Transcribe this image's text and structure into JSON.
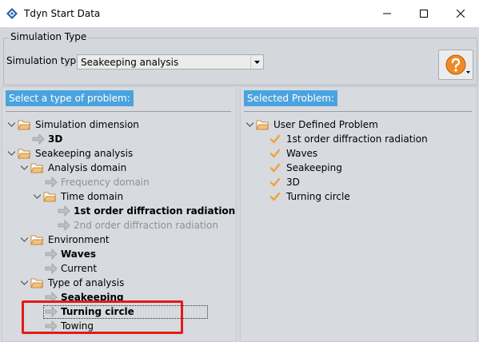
{
  "window": {
    "title": "Tdyn Start Data",
    "minimize_icon": "minimize-icon",
    "maximize_icon": "maximize-icon",
    "close_icon": "close-icon"
  },
  "simulation": {
    "group_title": "Simulation Type",
    "type_label": "Simulation type:",
    "type_value": "Seakeeping analysis",
    "help_icon": "question-icon"
  },
  "left_panel": {
    "header": "Select a type of problem:",
    "tree": {
      "simulation_dimension": "Simulation dimension",
      "dim_3d": "3D",
      "seakeeping_analysis": "Seakeeping analysis",
      "analysis_domain": "Analysis domain",
      "frequency_domain": "Frequency domain",
      "time_domain": "Time domain",
      "first_order": "1st order diffraction radiation",
      "second_order": "2nd order diffraction radiation",
      "environment": "Environment",
      "waves": "Waves",
      "current": "Current",
      "type_of_analysis": "Type of analysis",
      "seakeeping": "Seakeeping",
      "turning_circle": "Turning circle",
      "towing": "Towing"
    }
  },
  "right_panel": {
    "header": "Selected Problem:",
    "root": "User Defined Problem",
    "items": [
      "1st order diffraction radiation",
      "Waves",
      "Seakeeping",
      "3D",
      "Turning circle"
    ]
  },
  "colors": {
    "panel_header_bg": "#4aa3df",
    "check": "#f2a13a",
    "folder": "#e8a85a",
    "highlight": "#e21b1b"
  }
}
